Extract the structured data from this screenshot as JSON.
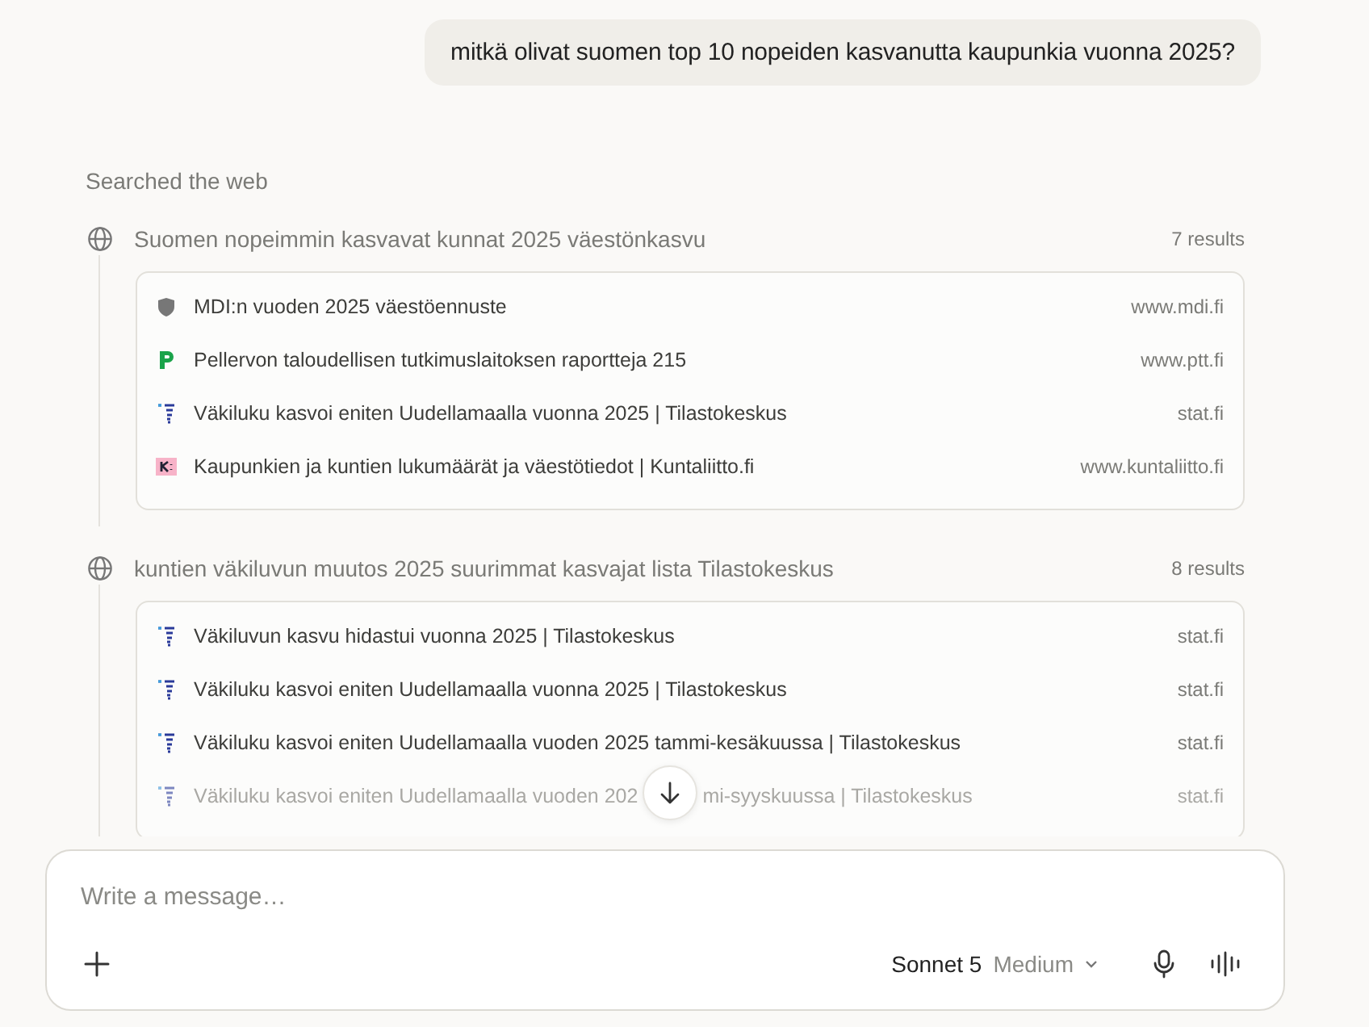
{
  "user_message": "mitkä olivat suomen top 10 nopeiden kasvanutta kaupunkia vuonna 2025?",
  "search_label": "Searched the web",
  "searches": [
    {
      "query": "Suomen nopeimmin kasvavat kunnat 2025 väestönkasvu",
      "count": "7 results",
      "results": [
        {
          "kind": "shield",
          "title": "MDI:n vuoden 2025 väestöennuste",
          "domain": "www.mdi.fi",
          "faded": false
        },
        {
          "kind": "p",
          "title": "Pellervon taloudellisen tutkimuslaitoksen raportteja 215",
          "domain": "www.ptt.fi",
          "faded": false
        },
        {
          "kind": "bars",
          "title": "Väkiluku kasvoi eniten Uudellamaalla vuonna 2025 | Tilastokeskus",
          "domain": "stat.fi",
          "faded": false
        },
        {
          "kind": "k",
          "title": "Kaupunkien ja kuntien lukumäärät ja väestötiedot | Kuntaliitto.fi",
          "domain": "www.kuntaliitto.fi",
          "faded": false
        }
      ]
    },
    {
      "query": "kuntien väkiluvun muutos 2025 suurimmat kasvajat lista Tilastokeskus",
      "count": "8 results",
      "results": [
        {
          "kind": "bars",
          "title": "Väkiluvun kasvu hidastui vuonna 2025 | Tilastokeskus",
          "domain": "stat.fi",
          "faded": false
        },
        {
          "kind": "bars",
          "title": "Väkiluku kasvoi eniten Uudellamaalla vuonna 2025 | Tilastokeskus",
          "domain": "stat.fi",
          "faded": false
        },
        {
          "kind": "bars",
          "title": "Väkiluku kasvoi eniten Uudellamaalla vuoden 2025 tammi-kesäkuussa | Tilastokeskus",
          "domain": "stat.fi",
          "faded": false
        },
        {
          "kind": "bars",
          "title": "Väkiluku kasvoi eniten Uudellamaalla vuoden 202",
          "title_after": "mi-syyskuussa | Tilastokeskus",
          "domain": "stat.fi",
          "faded": true
        }
      ]
    }
  ],
  "composer": {
    "placeholder": "Write a message…",
    "model": "Sonnet 5",
    "effort": "Medium"
  }
}
